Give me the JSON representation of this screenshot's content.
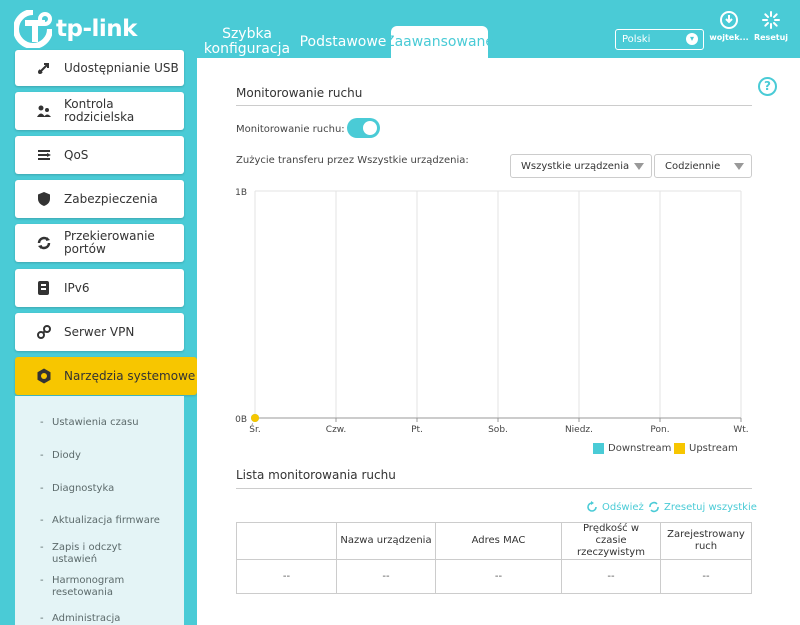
{
  "brand": {
    "name": "tp-link"
  },
  "nav": {
    "tabs": [
      {
        "label": "Szybka konfiguracja"
      },
      {
        "label": "Podstawowe"
      },
      {
        "label": "Zaawansowane"
      }
    ],
    "active_tab": "Zaawansowane"
  },
  "header": {
    "language": "Polski",
    "user_label": "wojtek...",
    "reset_label": "Resetuj"
  },
  "sidebar": {
    "items": [
      {
        "label": "Udostępnianie USB",
        "icon": "usb-icon"
      },
      {
        "label": "Kontrola rodzicielska",
        "icon": "parental-control-icon"
      },
      {
        "label": "QoS",
        "icon": "qos-icon"
      },
      {
        "label": "Zabezpieczenia",
        "icon": "shield-icon"
      },
      {
        "label": "Przekierowanie portów",
        "icon": "port-forwarding-icon"
      },
      {
        "label": "IPv6",
        "icon": "ipv6-icon"
      },
      {
        "label": "Serwer VPN",
        "icon": "vpn-icon"
      },
      {
        "label": "Narzędzia systemowe",
        "icon": "gear-icon"
      }
    ],
    "active_item": "Narzędzia systemowe",
    "sub_items": [
      {
        "label": "Ustawienia czasu"
      },
      {
        "label": "Diody"
      },
      {
        "label": "Diagnostyka"
      },
      {
        "label": "Aktualizacja firmware"
      },
      {
        "label": "Zapis i odczyt ustawień"
      },
      {
        "label": "Harmonogram resetowania"
      },
      {
        "label": "Administracja"
      }
    ]
  },
  "main": {
    "section_title": "Monitorowanie ruchu",
    "toggle_label": "Monitorowanie ruchu:",
    "toggle_on": true,
    "usage_label": "Zużycie transferu przez Wszystkie urządzenia:",
    "device_select": "Wszystkie urządzenia",
    "period_select": "Codziennie",
    "list_title": "Lista monitorowania ruchu",
    "refresh_label": "Odśwież",
    "reset_all_label": "Zresetuj wszystkie",
    "table": {
      "headers": [
        "",
        "Nazwa urządzenia",
        "Adres MAC",
        "Prędkość w czasie rzeczywistym",
        "Zarejestrowany ruch"
      ],
      "rows": [
        [
          "--",
          "--",
          "--",
          "--",
          "--"
        ]
      ]
    }
  },
  "colors": {
    "accent": "#4acbd6",
    "active_item": "#f7c600",
    "downstream": "#4acbd6",
    "upstream": "#f7c600"
  },
  "chart_data": {
    "type": "line",
    "x": [
      "Śr.",
      "Czw.",
      "Pt.",
      "Sob.",
      "Niedz.",
      "Pon.",
      "Wt."
    ],
    "y_ticks": [
      "0B",
      "1B"
    ],
    "ylim": [
      0,
      1
    ],
    "series": [
      {
        "name": "Downstream",
        "color": "#4acbd6",
        "values": [
          0,
          null,
          null,
          null,
          null,
          null,
          null
        ]
      },
      {
        "name": "Upstream",
        "color": "#f7c600",
        "values": [
          0,
          null,
          null,
          null,
          null,
          null,
          null
        ]
      }
    ],
    "legend": "bottom-right",
    "grid": true
  }
}
